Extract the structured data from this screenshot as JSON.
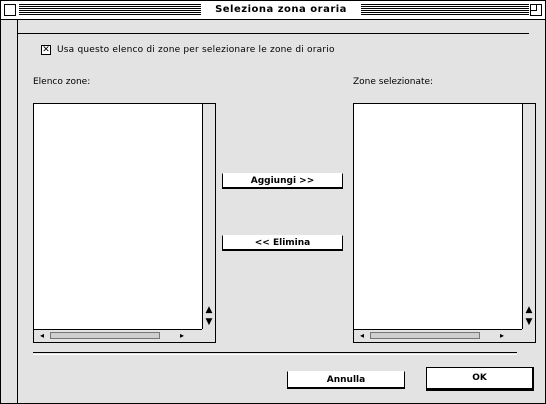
{
  "window": {
    "title": "Seleziona zona oraria"
  },
  "options": {
    "checkbox_label": "Usa questo elenco di zone per selezionare le zone di orario",
    "checkbox_checked": true
  },
  "left_list": {
    "label": "Elenco zone:",
    "items": []
  },
  "right_list": {
    "label": "Zone selezionate:",
    "items": []
  },
  "buttons": {
    "add_label": "Aggiungi >>",
    "remove_label": "<< Elimina",
    "cancel_label": "Annulla",
    "ok_label": "OK"
  }
}
